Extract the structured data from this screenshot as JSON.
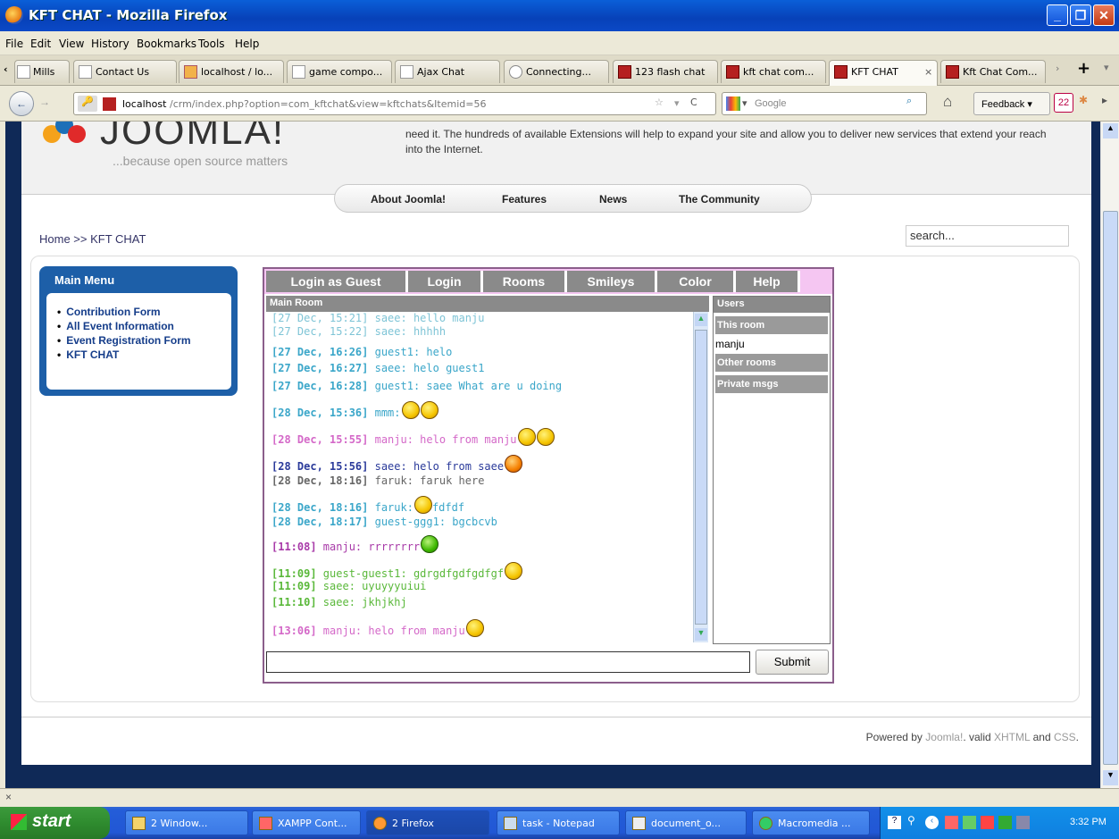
{
  "window": {
    "title": "KFT CHAT - Mozilla Firefox"
  },
  "menu": [
    "File",
    "Edit",
    "View",
    "History",
    "Bookmarks",
    "Tools",
    "Help"
  ],
  "tabs": [
    {
      "label": "Mills",
      "icon": "page-icon"
    },
    {
      "label": "Contact Us",
      "icon": "page-icon"
    },
    {
      "label": "localhost / lo...",
      "icon": "phpmyadmin-icon"
    },
    {
      "label": "game compo...",
      "icon": "page-icon"
    },
    {
      "label": "Ajax Chat",
      "icon": "page-icon"
    },
    {
      "label": "Connecting...",
      "icon": "loading-icon"
    },
    {
      "label": "123 flash chat",
      "icon": "kft-icon"
    },
    {
      "label": "kft chat com...",
      "icon": "kft-icon"
    },
    {
      "label": "KFT CHAT",
      "icon": "kft-icon",
      "active": true
    },
    {
      "label": "Kft Chat Com...",
      "icon": "kft-icon"
    }
  ],
  "nav": {
    "url_host": "localhost",
    "url_path": "/crm/index.php?option=com_kftchat&view=kftchats&Itemid=56",
    "search_placeholder": "Google",
    "feedback_label": "Feedback",
    "badge_count": "22"
  },
  "site": {
    "tagline": "...because open source matters",
    "intro": "need it. The hundreds of available Extensions will help to expand your site and allow you to deliver new services that extend your reach into the Internet.",
    "topnav": [
      "About Joomla!",
      "Features",
      "News",
      "The Community"
    ],
    "breadcrumb": "Home >> KFT CHAT",
    "search_value": "search...",
    "main_menu_title": "Main Menu",
    "main_menu": [
      "Contribution Form",
      "All Event Information",
      "Event Registration Form",
      "KFT CHAT"
    ],
    "footer": {
      "prefix": "Powered by",
      "joomla": "Joomla!",
      "mid1": ". valid",
      "xhtml": "XHTML",
      "mid2": "and",
      "css": "CSS",
      "end": "."
    }
  },
  "chat": {
    "buttons": [
      "Login as Guest",
      "Login",
      "Rooms",
      "Smileys",
      "Color",
      "Help"
    ],
    "room_title": "Main Room",
    "users_title": "Users",
    "this_room": "This room",
    "users": [
      "manju"
    ],
    "other_rooms": "Other rooms",
    "private_msgs": "Private msgs",
    "submit_label": "Submit",
    "messages": [
      {
        "time": "[27 Dec, 15:21]",
        "text": "saee: hello manju",
        "color": "#7ec4d6",
        "bold": false,
        "smileys": []
      },
      {
        "time": "[27 Dec, 15:22]",
        "text": "saee: hhhhh",
        "color": "#7ec4d6",
        "bold": false,
        "smileys": []
      },
      {
        "time": "[27 Dec, 16:26]",
        "text": "guest1: helo",
        "color": "#3aa6c9",
        "bold": true,
        "smileys": []
      },
      {
        "time": "[27 Dec, 16:27]",
        "text": "saee: helo guest1",
        "color": "#3aa6c9",
        "bold": true,
        "smileys": []
      },
      {
        "time": "[27 Dec, 16:28]",
        "text": "guest1: saee What are u doing",
        "color": "#3aa6c9",
        "bold": true,
        "smileys": []
      },
      {
        "time": "[28 Dec, 15:36]",
        "text": "mmm:",
        "color": "#3aa6c9",
        "bold": true,
        "smileys": [
          "yellow",
          "yellow"
        ]
      },
      {
        "time": "[28 Dec, 15:55]",
        "text": "manju: helo from manju",
        "color": "#d468c8",
        "bold": true,
        "smileys": [
          "yellow",
          "yellow"
        ]
      },
      {
        "time": "[28 Dec, 15:56]",
        "text": "saee: helo from saee",
        "color": "#2a3a9a",
        "bold": true,
        "smileys": [
          "orange"
        ]
      },
      {
        "time": "[28 Dec, 18:16]",
        "text": "faruk: faruk here",
        "color": "#666666",
        "bold": true,
        "smileys": []
      },
      {
        "time": "[28 Dec, 18:16]",
        "text": "faruk:",
        "color": "#3aa6c9",
        "bold": true,
        "smileys": [
          "yellow"
        ],
        "after": "fdfdf"
      },
      {
        "time": "[28 Dec, 18:17]",
        "text": "guest-ggg1: bgcbcvb",
        "color": "#3aa6c9",
        "bold": true,
        "smileys": []
      },
      {
        "time": "[11:08]",
        "text": "manju: rrrrrrrr",
        "color": "#a83aa8",
        "bold": true,
        "smileys": [
          "green"
        ]
      },
      {
        "time": "[11:09]",
        "text": "guest-guest1: gdrgdfgdfgdfgf",
        "color": "#5ab83a",
        "bold": true,
        "smileys": [
          "yellow"
        ]
      },
      {
        "time": "[11:09]",
        "text": "saee: uyuyyyuiui",
        "color": "#5ab83a",
        "bold": true,
        "smileys": []
      },
      {
        "time": "[11:10]",
        "text": "saee: jkhjkhj",
        "color": "#5ab83a",
        "bold": true,
        "smileys": []
      },
      {
        "time": "[13:06]",
        "text": "manju: helo from manju",
        "color": "#d468c8",
        "bold": true,
        "smileys": [
          "yellow"
        ]
      }
    ]
  },
  "taskbar": {
    "start": "start",
    "tasks": [
      "2 Window...",
      "XAMPP Cont...",
      "2 Firefox",
      "task - Notepad",
      "document_o...",
      "Macromedia ..."
    ],
    "clock": "3:32 PM"
  },
  "status_close": "×"
}
